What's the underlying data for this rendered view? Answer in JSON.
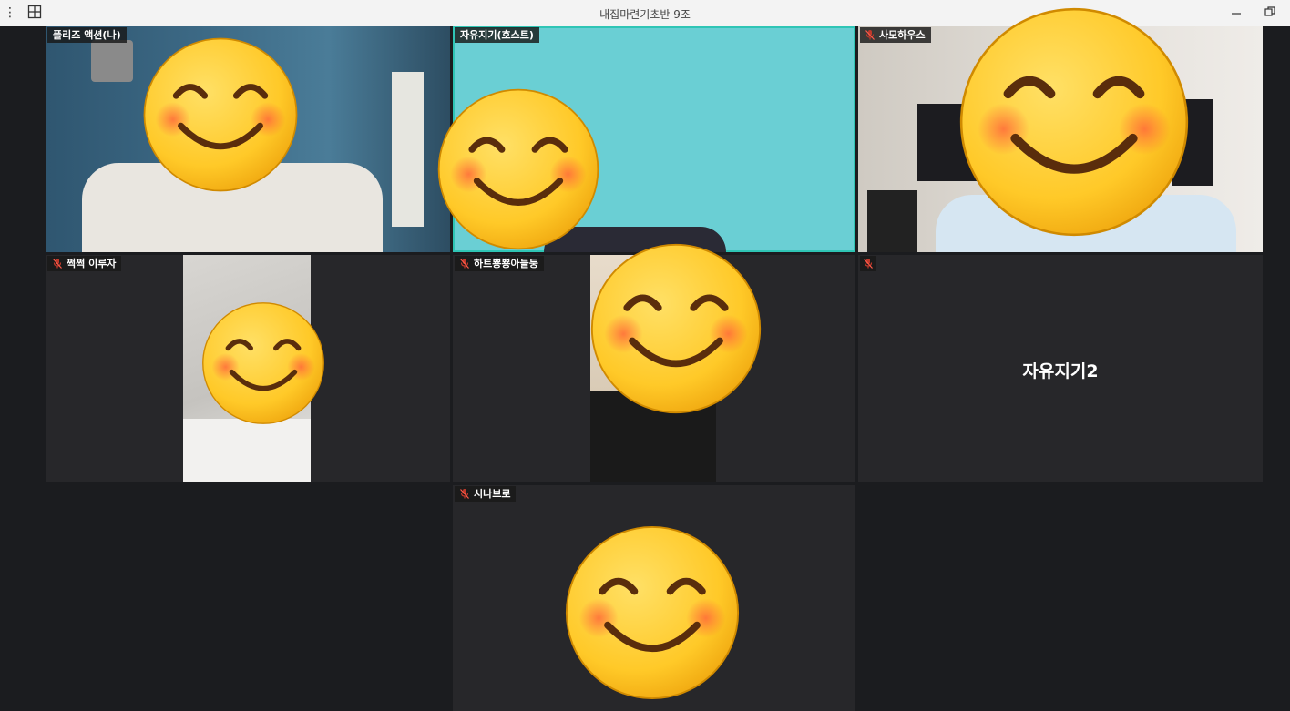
{
  "window": {
    "title": "내집마련기초반 9조"
  },
  "participants": [
    {
      "name": "플리즈 액션(나)"
    },
    {
      "name": "자유지기(호스트)"
    },
    {
      "name": "사모하우스"
    },
    {
      "name": "쩍쩍 이루자"
    },
    {
      "name": "하트뿅뿅아들둥"
    },
    {
      "name": "자유지기2"
    },
    {
      "name": "시나브로"
    }
  ],
  "colors": {
    "active_border": "#2fc5b5",
    "muted_mic": "#c0392b",
    "emoji_face": "#ffcc33"
  },
  "icons": [
    "more-icon",
    "grid-view-icon",
    "minimize-icon",
    "restore-icon",
    "muted-mic-icon",
    "smiley-face-icon"
  ]
}
